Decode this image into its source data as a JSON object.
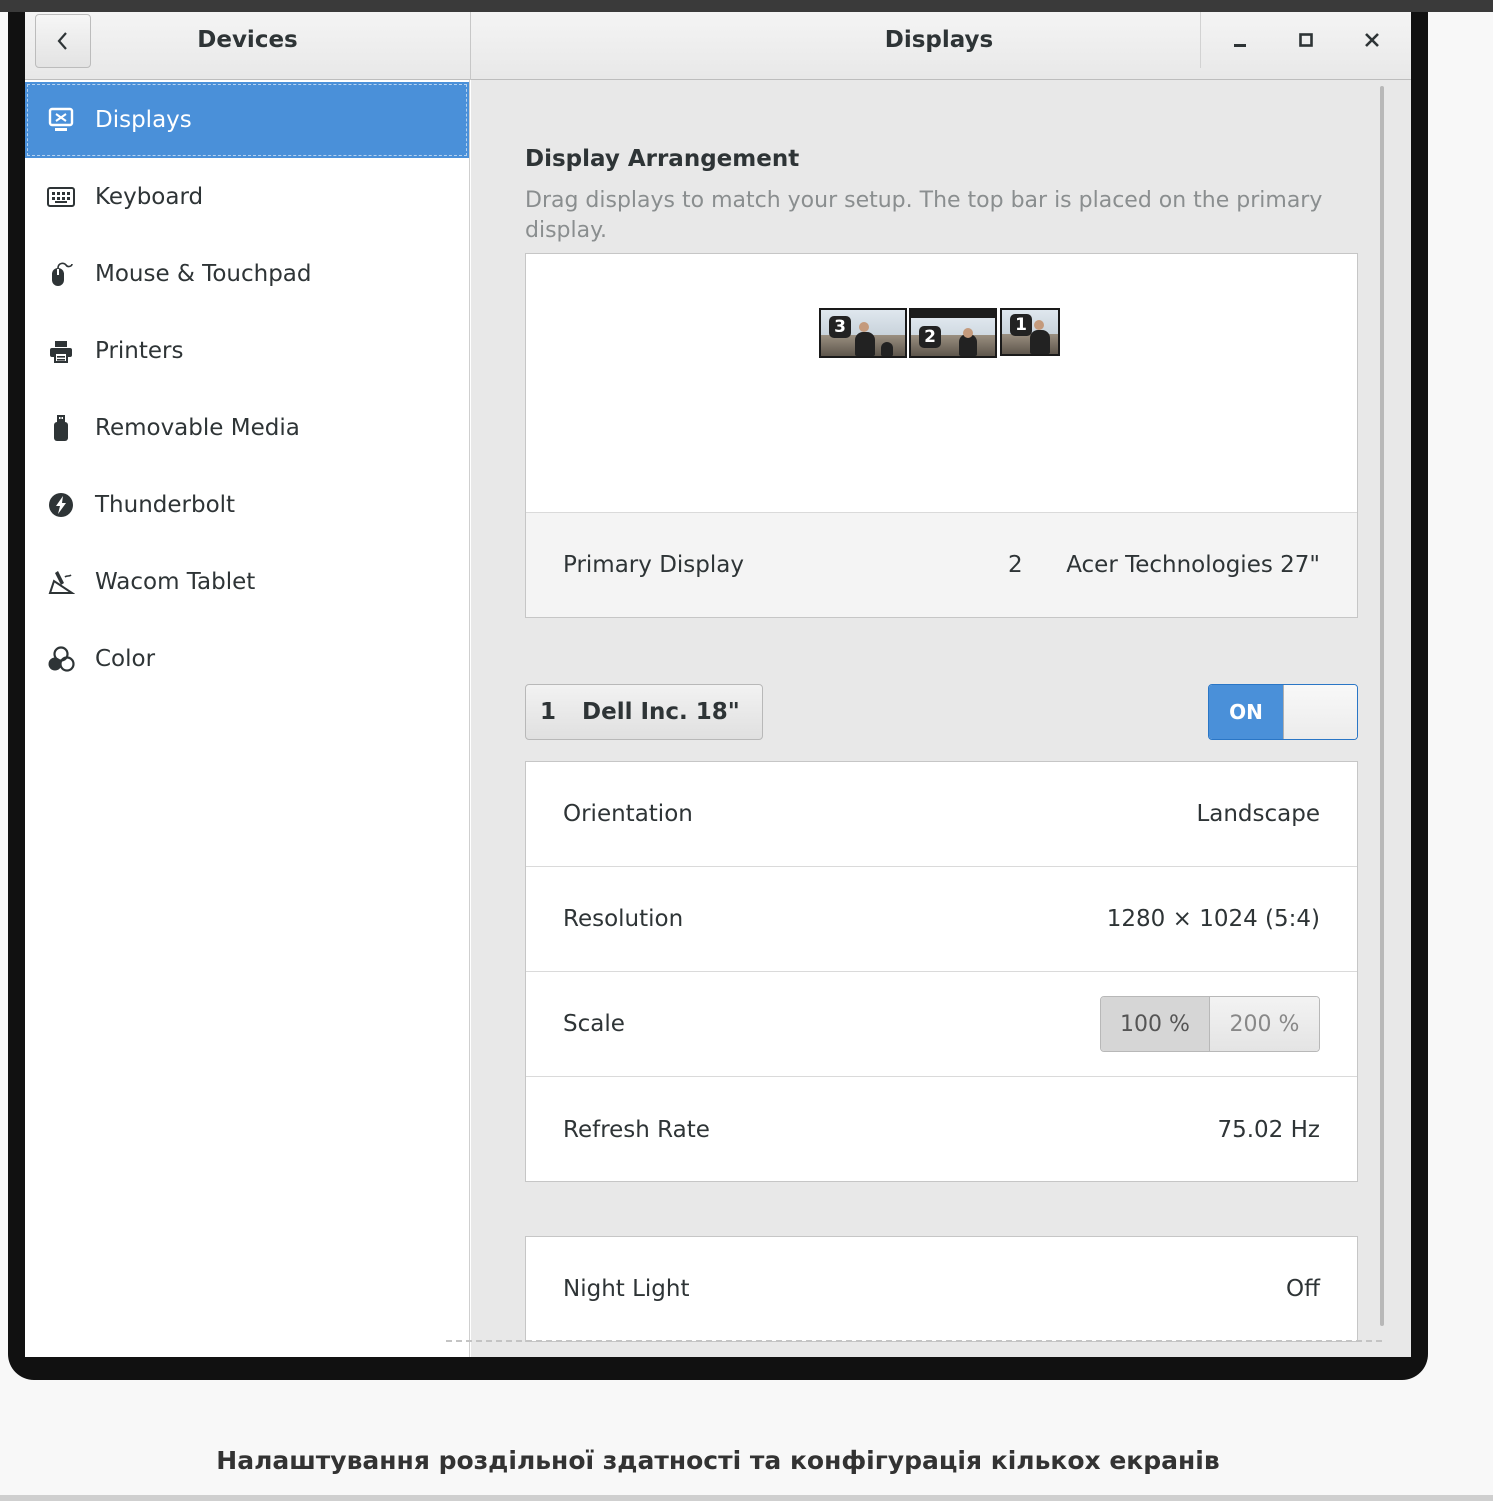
{
  "window": {
    "sidebar_title": "Devices",
    "main_title": "Displays"
  },
  "sidebar": {
    "items": [
      {
        "label": "Displays",
        "icon": "display-icon",
        "selected": true
      },
      {
        "label": "Keyboard",
        "icon": "keyboard-icon",
        "selected": false
      },
      {
        "label": "Mouse & Touchpad",
        "icon": "mouse-icon",
        "selected": false
      },
      {
        "label": "Printers",
        "icon": "printer-icon",
        "selected": false
      },
      {
        "label": "Removable Media",
        "icon": "usb-drive-icon",
        "selected": false
      },
      {
        "label": "Thunderbolt",
        "icon": "thunderbolt-icon",
        "selected": false
      },
      {
        "label": "Wacom Tablet",
        "icon": "tablet-pen-icon",
        "selected": false
      },
      {
        "label": "Color",
        "icon": "color-circles-icon",
        "selected": false
      }
    ]
  },
  "arrangement": {
    "title": "Display Arrangement",
    "description": "Drag displays to match your setup. The top bar is placed on the primary display.",
    "monitors": [
      {
        "number": "3"
      },
      {
        "number": "2"
      },
      {
        "number": "1"
      }
    ],
    "primary_label": "Primary Display",
    "primary_number": "2",
    "primary_name": "Acer Technologies 27\""
  },
  "selected_display": {
    "number": "1",
    "name": "Dell Inc. 18\"",
    "power": "ON"
  },
  "settings": {
    "orientation_label": "Orientation",
    "orientation_value": "Landscape",
    "resolution_label": "Resolution",
    "resolution_value": "1280 × 1024 (5:4)",
    "scale_label": "Scale",
    "scale_options": [
      "100 %",
      "200 %"
    ],
    "refresh_label": "Refresh Rate",
    "refresh_value": "75.02 Hz"
  },
  "night_light": {
    "label": "Night Light",
    "value": "Off"
  },
  "caption": "Налаштування роздільної здатності та конфігурація кількох екранів",
  "colors": {
    "accent": "#4a90d9",
    "pane_background": "#e8e8e8"
  }
}
